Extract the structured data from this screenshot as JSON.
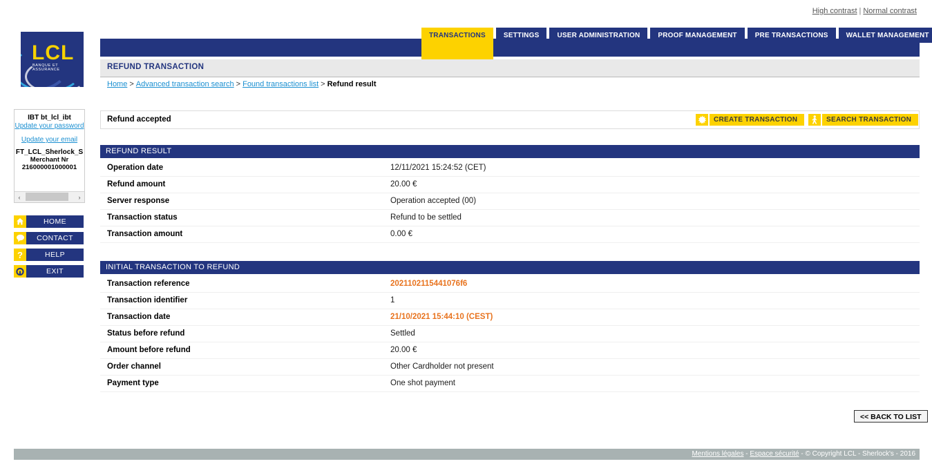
{
  "contrast": {
    "high": "High contrast",
    "separator": "|",
    "normal": "Normal contrast"
  },
  "logo": {
    "name": "LCL",
    "tagline": "BANQUE ET ASSURANCE"
  },
  "tabs": [
    {
      "label": "TRANSACTIONS",
      "active": true
    },
    {
      "label": "SETTINGS",
      "active": false
    },
    {
      "label": "USER ADMINISTRATION",
      "active": false
    },
    {
      "label": "PROOF MANAGEMENT",
      "active": false
    },
    {
      "label": "PRE TRANSACTIONS",
      "active": false
    },
    {
      "label": "WALLET MANAGEMENT",
      "active": false
    }
  ],
  "page": {
    "title": "REFUND TRANSACTION"
  },
  "breadcrumb": {
    "home": "Home",
    "search": "Advanced transaction search",
    "list": "Found transactions list",
    "current": "Refund result",
    "separator": ">"
  },
  "sidebar": {
    "user_id": "IBT bt_lcl_ibt",
    "update_password": "Update your password",
    "update_email": "Update your email",
    "merchant_name": "FT_LCL_Sherlock_S",
    "merchant_label": "Merchant Nr",
    "merchant_number": "216000001000001",
    "scroll_left": "‹",
    "scroll_right": "›",
    "nav": [
      {
        "label": "HOME",
        "icon": "home-icon"
      },
      {
        "label": "CONTACT",
        "icon": "speech-bubble-icon"
      },
      {
        "label": "HELP",
        "icon": "question-mark-icon"
      },
      {
        "label": "EXIT",
        "icon": "power-icon"
      }
    ]
  },
  "status": {
    "message": "Refund accepted"
  },
  "actions": {
    "create": "CREATE TRANSACTION",
    "search": "SEARCH TRANSACTION"
  },
  "refund_result": {
    "heading": "REFUND RESULT",
    "rows": [
      {
        "key": "Operation date",
        "value": "12/11/2021 15:24:52 (CET)",
        "highlight": false
      },
      {
        "key": "Refund amount",
        "value": "20.00 €",
        "highlight": false
      },
      {
        "key": "Server response",
        "value": "Operation accepted (00)",
        "highlight": false
      },
      {
        "key": "Transaction status",
        "value": "Refund to be settled",
        "highlight": false
      },
      {
        "key": "Transaction amount",
        "value": "0.00 €",
        "highlight": false
      }
    ]
  },
  "initial_transaction": {
    "heading": "INITIAL TRANSACTION TO REFUND",
    "rows": [
      {
        "key": "Transaction reference",
        "value": "2021102115441076f6",
        "highlight": true
      },
      {
        "key": "Transaction identifier",
        "value": "1",
        "highlight": false
      },
      {
        "key": "Transaction date",
        "value": "21/10/2021 15:44:10 (CEST)",
        "highlight": true
      },
      {
        "key": "Status before refund",
        "value": "Settled",
        "highlight": false
      },
      {
        "key": "Amount before refund",
        "value": "20.00 €",
        "highlight": false
      },
      {
        "key": "Order channel",
        "value": "Other Cardholder not present",
        "highlight": false
      },
      {
        "key": "Payment type",
        "value": "One shot payment",
        "highlight": false
      }
    ]
  },
  "back_button": "<< BACK TO LIST",
  "footer": {
    "legal": "Mentions légales",
    "security": "Espace sécurité",
    "copyright": "© Copyright LCL - Sherlock's - 2016",
    "separator": "-"
  },
  "colors": {
    "navy": "#23357f",
    "yellow": "#fdd200",
    "link": "#1a8fd1",
    "highlight": "#e8731e"
  }
}
